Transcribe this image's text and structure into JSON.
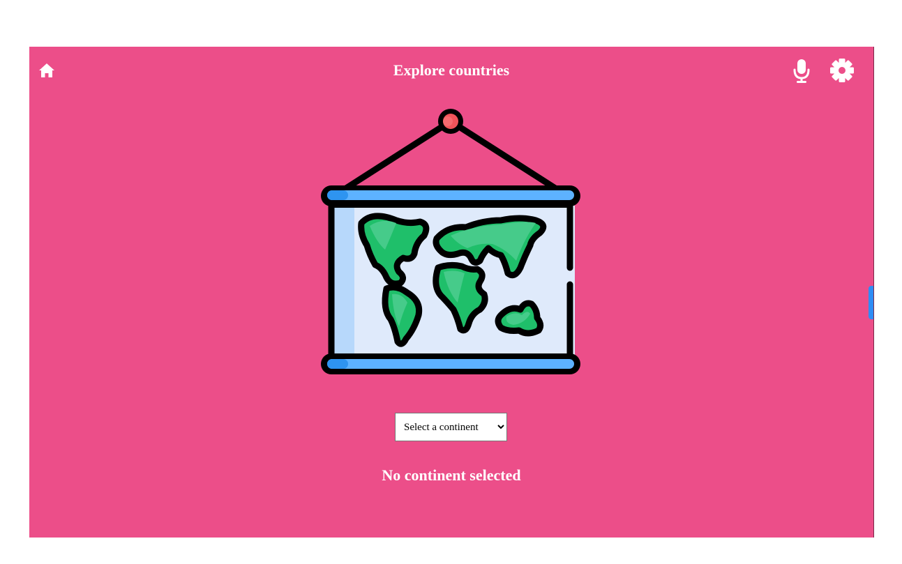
{
  "header": {
    "title": "Explore countries",
    "home_icon": "home-icon",
    "mic_icon": "microphone-icon",
    "settings_icon": "gear-icon"
  },
  "illustration": {
    "icon": "world-map-poster-icon"
  },
  "continent_select": {
    "selected": "Select a continent",
    "options": [
      "Select a continent"
    ]
  },
  "status": {
    "message": "No continent selected"
  },
  "colors": {
    "background": "#ec4e89",
    "text": "#ffffff",
    "map_land": "#1fbf6a",
    "map_land_light": "#46cb8a",
    "map_paper": "#dfeafb",
    "rod_blue": "#5db2ff",
    "pin_red": "#f1545a",
    "side_tab": "#2f8df5"
  }
}
